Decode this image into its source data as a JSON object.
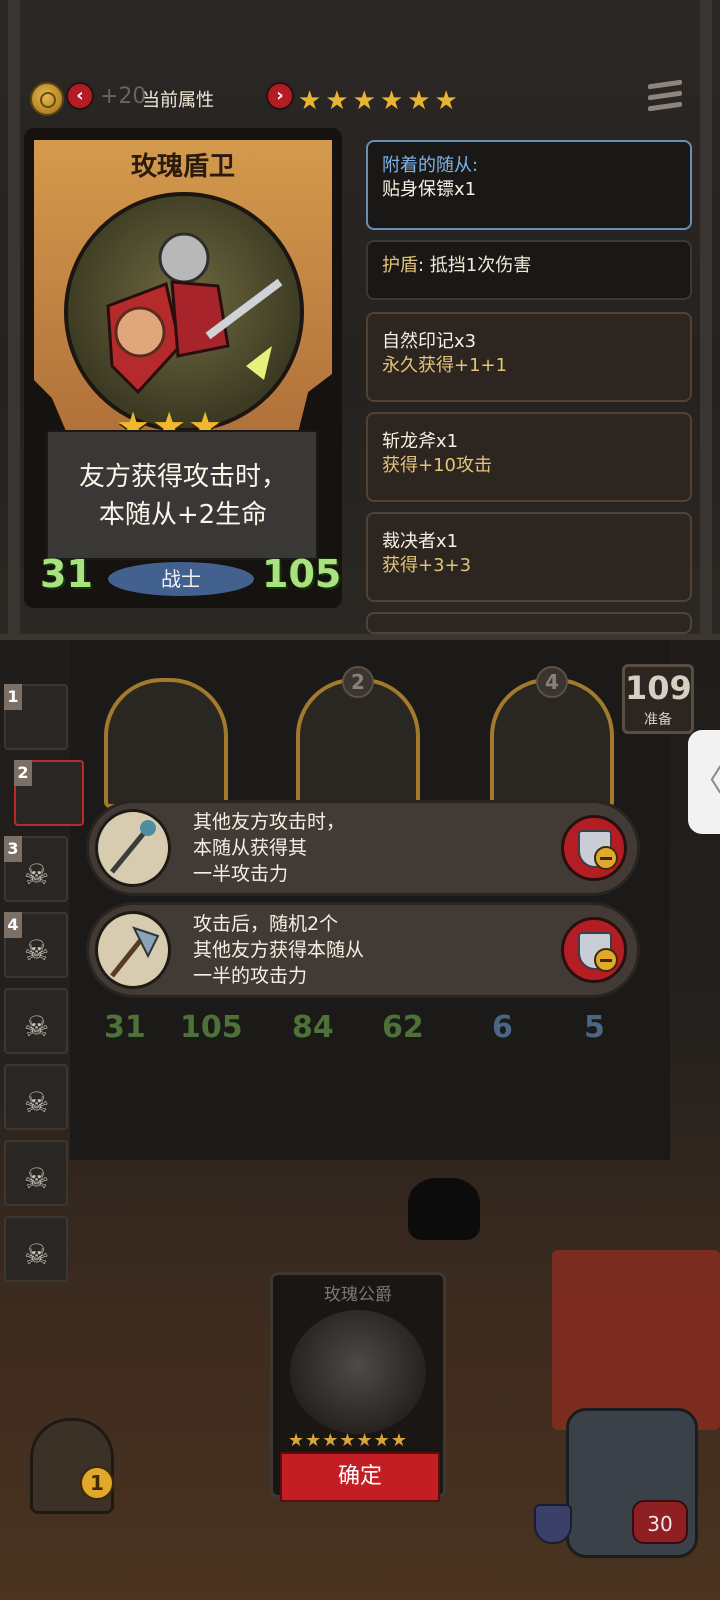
{
  "header": {
    "faded_value": "+20",
    "title": "当前属性",
    "stars": "★★★★★★",
    "prev_glyph": "‹",
    "next_glyph": "›"
  },
  "unit_card": {
    "name": "玫瑰盾卫",
    "stars": "★★★",
    "ability_line1": "友方获得攻击时，",
    "ability_line2": "本随从+2生命",
    "attack": "31",
    "health": "105",
    "class": "战士"
  },
  "attached": {
    "title": "附着的随从:",
    "value": "贴身保镖x1"
  },
  "shield": {
    "label": "护盾",
    "text": ": 抵挡1次伤害"
  },
  "items": [
    {
      "name": "自然印记x3",
      "effect": "永久获得+1+1"
    },
    {
      "name": "斩龙斧x1",
      "effect": "获得+10攻击"
    },
    {
      "name": "裁决者x1",
      "effect": "获得+3+3"
    }
  ],
  "sidebar_slots": [
    "1",
    "2",
    "3",
    "4"
  ],
  "board_units": [
    "2",
    "4"
  ],
  "prep": {
    "value": "109",
    "label": "准备"
  },
  "side_tab_glyph": "〈",
  "popups": [
    {
      "line1": "其他友方攻击时，",
      "line2": "本随从获得其",
      "line3": "一半攻击力"
    },
    {
      "line1": "攻击后，随机2个",
      "line2": "其他友方获得本随从",
      "line3": "一半的攻击力"
    }
  ],
  "board_stats": [
    {
      "atk": "31",
      "hp": "105"
    },
    {
      "atk": "84",
      "hp": "62"
    },
    {
      "atk": "6",
      "hp": "5"
    }
  ],
  "shop": {
    "name": "玫瑰公爵",
    "stars": "★★★★★★★",
    "confirm": "确定"
  },
  "lantern_count": "1",
  "hero_hp": "30",
  "colors": {
    "accent_red": "#c21e24",
    "stat_green": "#a9e27f",
    "gold": "#e9b431",
    "attached_blue": "#7fb2e6",
    "effect_gold": "#e2c37a"
  },
  "icons": [
    "gold-coin-icon",
    "menu-icon",
    "skull-icon",
    "shield-minus-icon",
    "staff-icon",
    "axe-icon",
    "chevron-left-icon"
  ]
}
